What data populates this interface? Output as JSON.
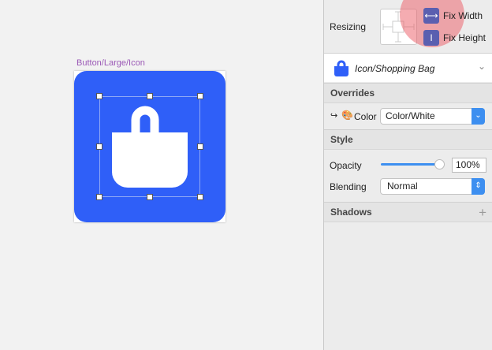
{
  "canvas": {
    "artboard_label": "Button/Large/Icon",
    "button_color": "#2f5ff8"
  },
  "inspector": {
    "resizing": {
      "label": "Resizing",
      "fix_width": "Fix Width",
      "fix_height": "Fix Height"
    },
    "symbol": {
      "name": "Icon/Shopping Bag"
    },
    "overrides": {
      "title": "Overrides",
      "color_label": "Color",
      "color_value": "Color/White"
    },
    "style": {
      "title": "Style",
      "opacity_label": "Opacity",
      "opacity_value": "100%",
      "opacity_fraction": 1.0,
      "blending_label": "Blending",
      "blending_value": "Normal"
    },
    "shadows": {
      "title": "Shadows",
      "add": "+"
    }
  }
}
